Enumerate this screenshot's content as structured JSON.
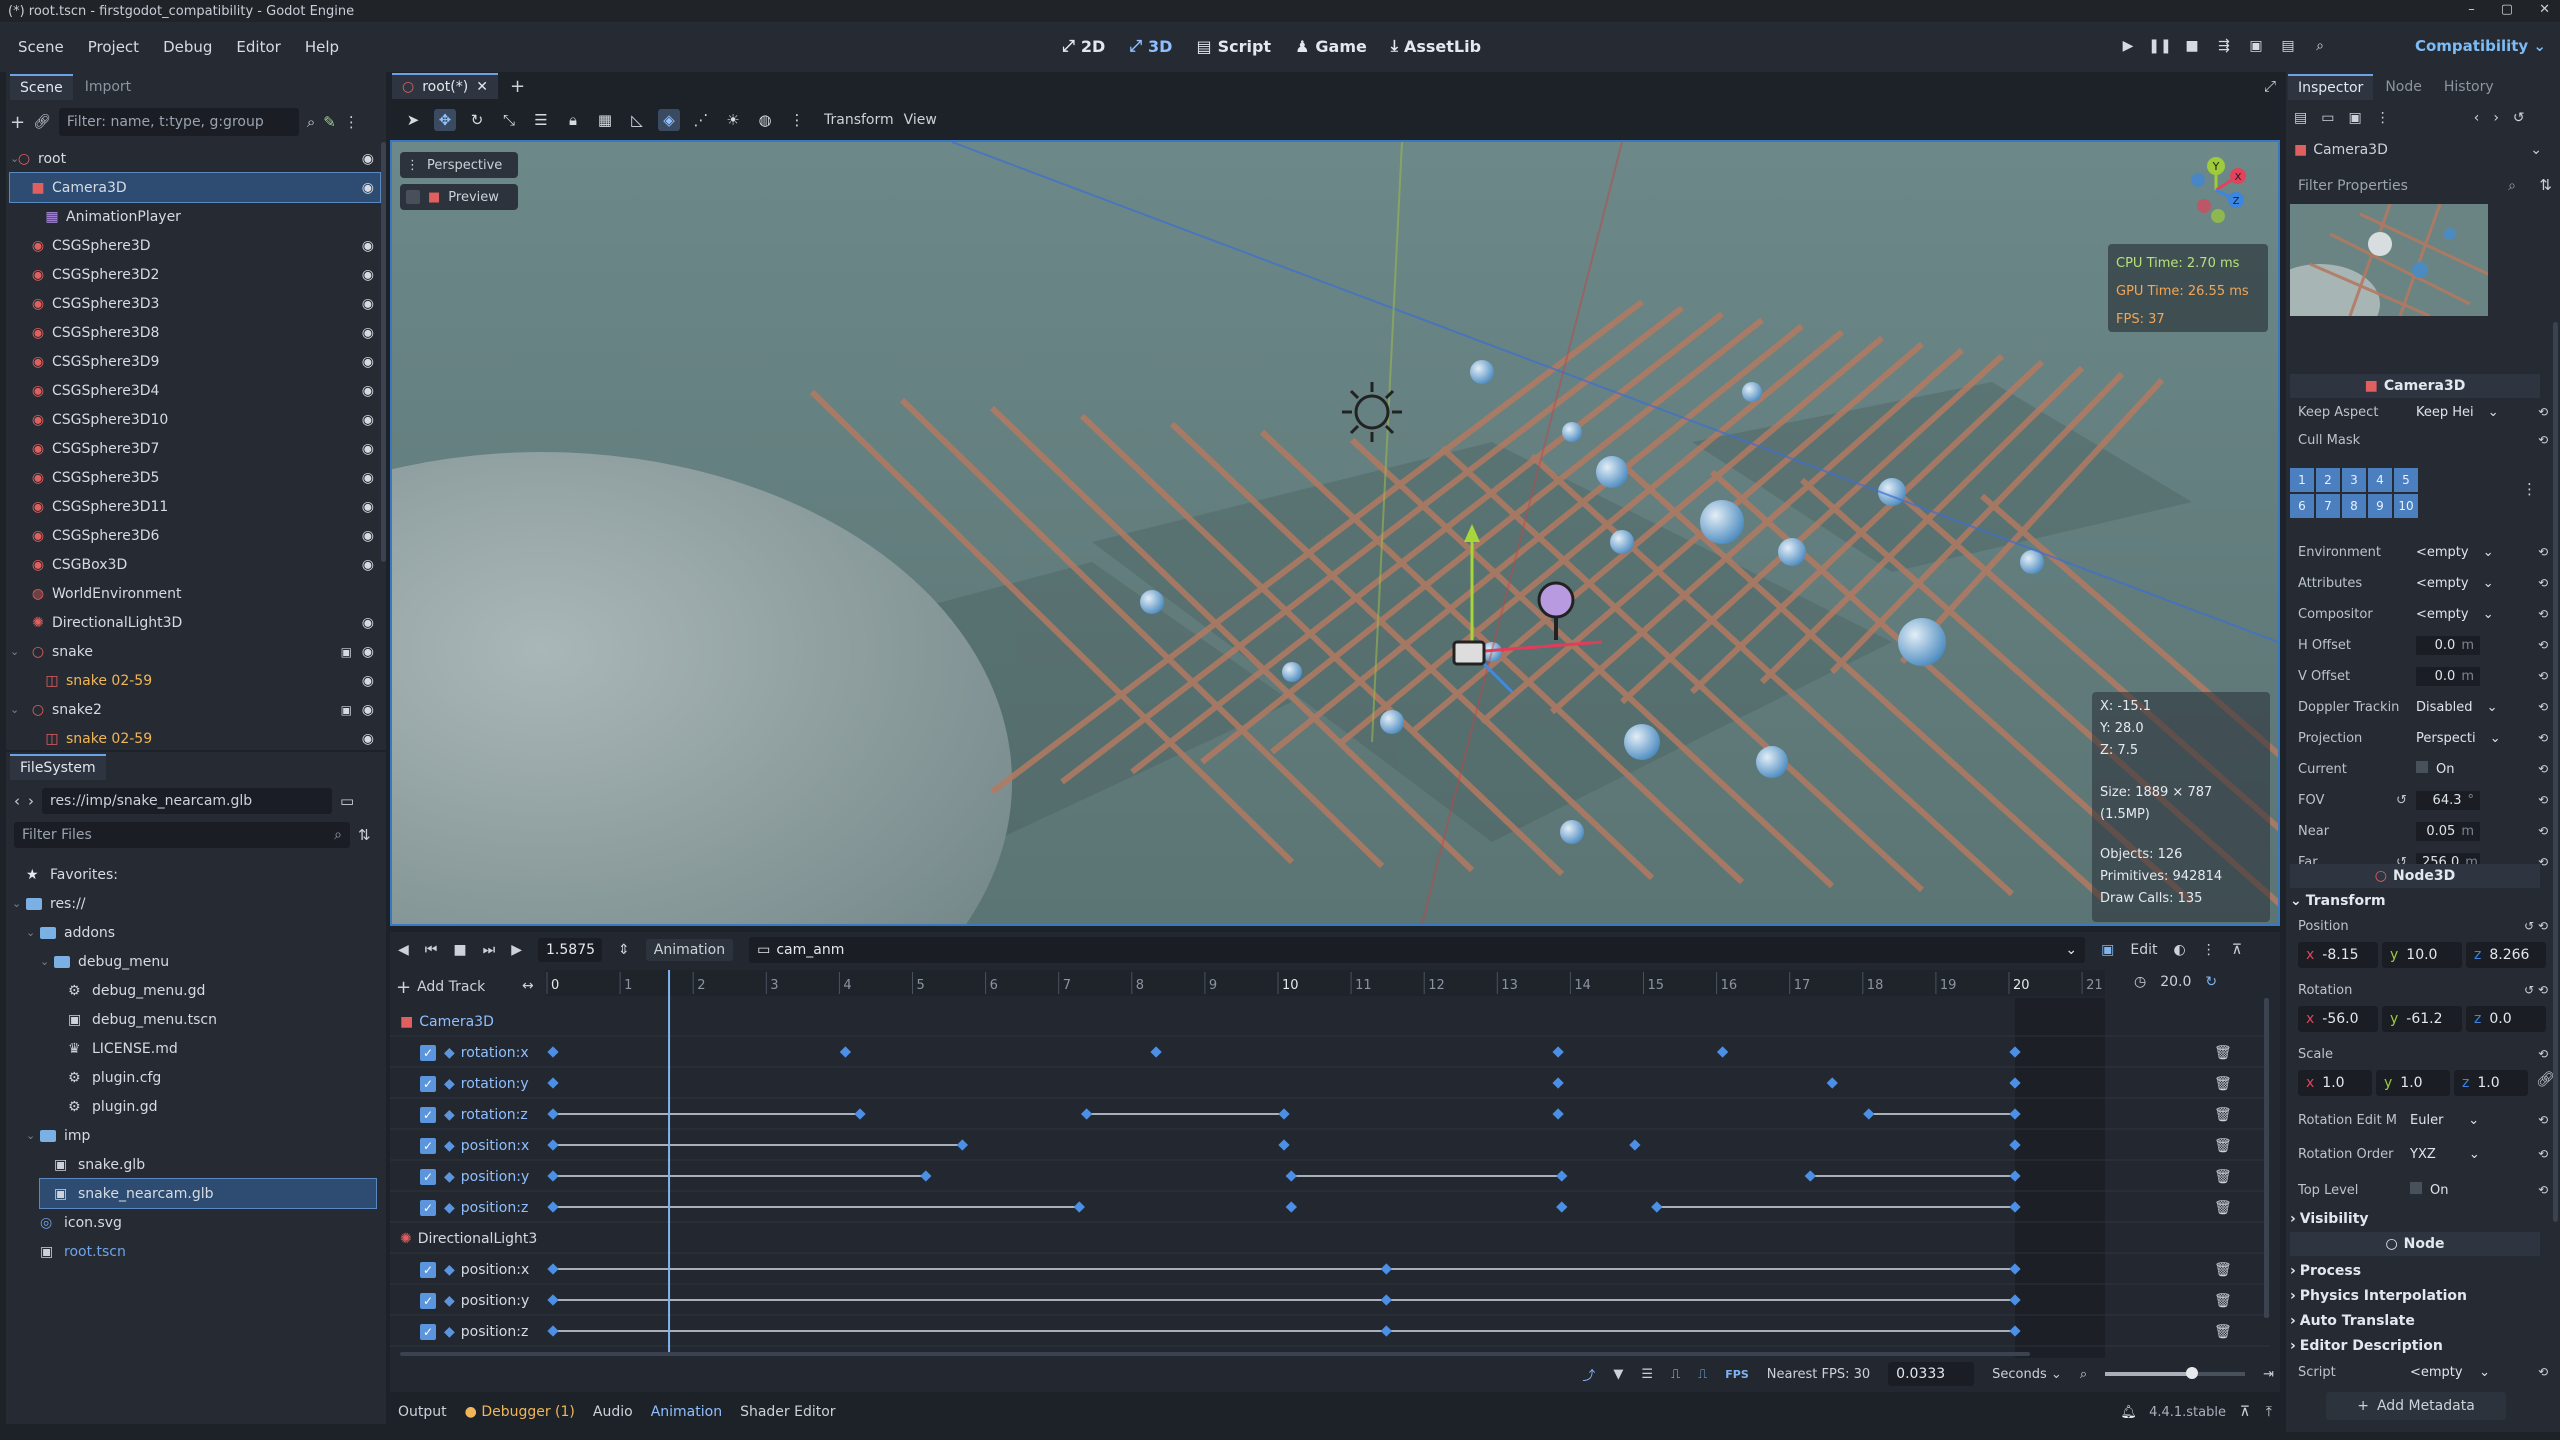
{
  "window": {
    "title": "(*) root.tscn - firstgodot_compatibility - Godot Engine",
    "controls": [
      "–",
      "▢",
      "✕"
    ]
  },
  "menu": [
    "Scene",
    "Project",
    "Debug",
    "Editor",
    "Help"
  ],
  "workspaces": [
    {
      "label": "2D",
      "icon": "2d-icon"
    },
    {
      "label": "3D",
      "icon": "3d-icon"
    },
    {
      "label": "Script",
      "icon": "script-icon"
    },
    {
      "label": "Game",
      "icon": "game-icon"
    },
    {
      "label": "AssetLib",
      "icon": "assetlib-icon"
    }
  ],
  "renderer": "Compatibility",
  "scene_panel": {
    "tabs": [
      "Scene",
      "Import"
    ],
    "filter_placeholder": "Filter: name, t:type, g:group",
    "nodes": [
      {
        "label": "root",
        "depth": 0,
        "icon": "node3d-icon",
        "color": "#e06060",
        "eye": true
      },
      {
        "label": "Camera3D",
        "depth": 1,
        "icon": "camera-icon",
        "color": "#e06060",
        "eye": true,
        "selected": true
      },
      {
        "label": "AnimationPlayer",
        "depth": 2,
        "icon": "animation-icon",
        "color": "#b08ee8",
        "eye": false
      },
      {
        "label": "CSGSphere3D",
        "depth": 1,
        "icon": "csg-icon",
        "color": "#e06060",
        "eye": true
      },
      {
        "label": "CSGSphere3D2",
        "depth": 1,
        "icon": "csg-icon",
        "color": "#e06060",
        "eye": true
      },
      {
        "label": "CSGSphere3D3",
        "depth": 1,
        "icon": "csg-icon",
        "color": "#e06060",
        "eye": true
      },
      {
        "label": "CSGSphere3D8",
        "depth": 1,
        "icon": "csg-icon",
        "color": "#e06060",
        "eye": true
      },
      {
        "label": "CSGSphere3D9",
        "depth": 1,
        "icon": "csg-icon",
        "color": "#e06060",
        "eye": true
      },
      {
        "label": "CSGSphere3D4",
        "depth": 1,
        "icon": "csg-icon",
        "color": "#e06060",
        "eye": true
      },
      {
        "label": "CSGSphere3D10",
        "depth": 1,
        "icon": "csg-icon",
        "color": "#e06060",
        "eye": true
      },
      {
        "label": "CSGSphere3D7",
        "depth": 1,
        "icon": "csg-icon",
        "color": "#e06060",
        "eye": true
      },
      {
        "label": "CSGSphere3D5",
        "depth": 1,
        "icon": "csg-icon",
        "color": "#e06060",
        "eye": true
      },
      {
        "label": "CSGSphere3D11",
        "depth": 1,
        "icon": "csg-icon",
        "color": "#e06060",
        "eye": true
      },
      {
        "label": "CSGSphere3D6",
        "depth": 1,
        "icon": "csg-icon",
        "color": "#e06060",
        "eye": true
      },
      {
        "label": "CSGBox3D",
        "depth": 1,
        "icon": "csg-icon",
        "color": "#e06060",
        "eye": true
      },
      {
        "label": "WorldEnvironment",
        "depth": 1,
        "icon": "world-icon",
        "color": "#e06060",
        "eye": false
      },
      {
        "label": "DirectionalLight3D",
        "depth": 1,
        "icon": "light-icon",
        "color": "#e06060",
        "eye": true
      },
      {
        "label": "snake",
        "depth": 1,
        "icon": "node3d-icon",
        "color": "#e06060",
        "eye": true,
        "expanded": true
      },
      {
        "label": "snake 02-59",
        "depth": 2,
        "icon": "mesh-icon",
        "color": "#e06060",
        "eye": true,
        "orange": true
      },
      {
        "label": "snake2",
        "depth": 1,
        "icon": "node3d-icon",
        "color": "#e06060",
        "eye": true,
        "expanded": true
      },
      {
        "label": "snake 02-59",
        "depth": 2,
        "icon": "mesh-icon",
        "color": "#e06060",
        "eye": true,
        "orange": true
      }
    ]
  },
  "filesystem": {
    "tab": "FileSystem",
    "path": "res://imp/snake_nearcam.glb",
    "filter_placeholder": "Filter Files",
    "items": [
      {
        "label": "Favorites:",
        "depth": 0,
        "kind": "star"
      },
      {
        "label": "res://",
        "depth": 0,
        "kind": "folder"
      },
      {
        "label": "addons",
        "depth": 1,
        "kind": "folder"
      },
      {
        "label": "debug_menu",
        "depth": 2,
        "kind": "folder"
      },
      {
        "label": "debug_menu.gd",
        "depth": 3,
        "kind": "gear"
      },
      {
        "label": "debug_menu.tscn",
        "depth": 3,
        "kind": "scene"
      },
      {
        "label": "LICENSE.md",
        "depth": 3,
        "kind": "doc"
      },
      {
        "label": "plugin.cfg",
        "depth": 3,
        "kind": "gear"
      },
      {
        "label": "plugin.gd",
        "depth": 3,
        "kind": "gear"
      },
      {
        "label": "imp",
        "depth": 1,
        "kind": "folder"
      },
      {
        "label": "snake.glb",
        "depth": 2,
        "kind": "scene"
      },
      {
        "label": "snake_nearcam.glb",
        "depth": 2,
        "kind": "scene",
        "selected": true
      },
      {
        "label": "icon.svg",
        "depth": 1,
        "kind": "svg"
      },
      {
        "label": "root.tscn",
        "depth": 1,
        "kind": "scene",
        "link": true
      }
    ]
  },
  "viewport": {
    "scene_tab": "root(*)",
    "toolbar_menus": [
      "Transform",
      "View"
    ],
    "perspective_label": "Perspective",
    "preview_label": "Preview",
    "perf": {
      "cpu": "CPU Time: 2.70 ms",
      "gpu": "GPU Time: 26.55 ms",
      "fps": "FPS: 37"
    },
    "coords": {
      "x": "X: -15.1",
      "y": "Y: 28.0",
      "z": "Z: 7.5"
    },
    "size": "Size: 1889 × 787 (1.5MP)",
    "stats": {
      "objects": "Objects: 126",
      "primitives": "Primitives: 942814",
      "drawcalls": "Draw Calls: 135"
    },
    "gizmo": {
      "y": "Y",
      "x": "X",
      "z": "Z"
    }
  },
  "animation": {
    "time": "1.5875",
    "menu_label": "Animation",
    "anim_name": "cam_anm",
    "edit_label": "Edit",
    "add_track": "Add Track",
    "length": "20.0",
    "ruler_labels": [
      "0",
      "1",
      "2",
      "3",
      "4",
      "5",
      "6",
      "7",
      "8",
      "9",
      "10",
      "11",
      "12",
      "13",
      "14",
      "15",
      "16",
      "17",
      "18",
      "19",
      "20",
      "21"
    ],
    "tracks": [
      {
        "group": "Camera3D",
        "icon": "camera-icon"
      },
      {
        "prop": "rotation:x",
        "keys": [
          0,
          4,
          8.25,
          13.75,
          16,
          20
        ],
        "lines": [],
        "active": true
      },
      {
        "prop": "rotation:y",
        "keys": [
          0,
          13.75,
          17.5,
          20
        ],
        "lines": [],
        "active": true
      },
      {
        "prop": "rotation:z",
        "keys": [
          0,
          4.2,
          7.3,
          10,
          13.75,
          18,
          20
        ],
        "lines": [
          [
            0,
            4.2
          ],
          [
            7.3,
            10
          ],
          [
            18,
            20
          ]
        ],
        "active": true
      },
      {
        "prop": "position:x",
        "keys": [
          0,
          5.6,
          10,
          14.8,
          20
        ],
        "lines": [
          [
            0,
            5.6
          ]
        ],
        "active": true
      },
      {
        "prop": "position:y",
        "keys": [
          0,
          5.1,
          10.1,
          13.8,
          17.2,
          20
        ],
        "lines": [
          [
            0,
            5.1
          ],
          [
            10.1,
            13.8
          ],
          [
            17.2,
            20
          ]
        ],
        "active": true
      },
      {
        "prop": "position:z",
        "keys": [
          0,
          7.2,
          10.1,
          13.8,
          15.1,
          20
        ],
        "lines": [
          [
            0,
            7.2
          ],
          [
            15.1,
            20
          ]
        ],
        "active": true
      },
      {
        "group": "DirectionalLight3",
        "icon": "light-icon"
      },
      {
        "prop": "position:x",
        "keys": [
          0,
          11.4,
          20
        ],
        "lines": [
          [
            0,
            20
          ]
        ],
        "active": true
      },
      {
        "prop": "position:y",
        "keys": [
          0,
          11.4,
          20
        ],
        "lines": [
          [
            0,
            20
          ]
        ],
        "active": true
      },
      {
        "prop": "position:z",
        "keys": [
          0,
          11.4,
          20
        ],
        "lines": [
          [
            0,
            20
          ]
        ],
        "active": true
      }
    ],
    "playhead": 1.5875,
    "snap_label": "Nearest FPS: 30",
    "step": "0.0333",
    "unit": "Seconds"
  },
  "bottom_tabs": [
    "Output",
    "Debugger (1)",
    "Audio",
    "Animation",
    "Shader Editor"
  ],
  "version": "4.4.1.stable",
  "inspector": {
    "tabs": [
      "Inspector",
      "Node",
      "History"
    ],
    "object": "Camera3D",
    "filter_placeholder": "Filter Properties",
    "class_header": "Camera3D",
    "props": [
      {
        "label": "Keep Aspect",
        "value": "Keep Hei",
        "dropdown": true
      },
      {
        "label": "Cull Mask",
        "value": ""
      },
      {
        "label": "Environment",
        "value": "<empty",
        "dropdown": true
      },
      {
        "label": "Attributes",
        "value": "<empty",
        "dropdown": true
      },
      {
        "label": "Compositor",
        "value": "<empty",
        "dropdown": true
      },
      {
        "label": "H Offset",
        "value": "0.0",
        "unit": "m"
      },
      {
        "label": "V Offset",
        "value": "0.0",
        "unit": "m"
      },
      {
        "label": "Doppler Trackin",
        "value": "Disabled",
        "dropdown": true
      },
      {
        "label": "Projection",
        "value": "Perspecti",
        "dropdown": true
      },
      {
        "label": "Current",
        "value": "On",
        "checkbox": true
      },
      {
        "label": "FOV",
        "value": "64.3",
        "unit": "°"
      },
      {
        "label": "Near",
        "value": "0.05",
        "unit": "m"
      },
      {
        "label": "Far",
        "value": "256.0",
        "unit": "m"
      }
    ],
    "layers": [
      "1",
      "2",
      "3",
      "4",
      "5",
      "6",
      "7",
      "8",
      "9",
      "10"
    ],
    "node3d_header": "Node3D",
    "transform": {
      "title": "Transform",
      "position_label": "Position",
      "position": {
        "x": "-8.15",
        "y": "10.0",
        "z": "8.266"
      },
      "rotation_label": "Rotation",
      "rotation": {
        "x": "-56.0",
        "y": "-61.2",
        "z": "0.0"
      },
      "scale_label": "Scale",
      "scale": {
        "x": "1.0",
        "y": "1.0",
        "z": "1.0"
      },
      "rot_edit_label": "Rotation Edit M",
      "rot_edit": "Euler",
      "rot_order_label": "Rotation Order",
      "rot_order": "YXZ",
      "top_level_label": "Top Level",
      "top_level": "On"
    },
    "visibility": "Visibility",
    "node_header": "Node",
    "sections": [
      "Process",
      "Physics Interpolation",
      "Auto Translate",
      "Editor Description"
    ],
    "script_label": "Script",
    "script_value": "<empty",
    "add_metadata": "Add Metadata"
  },
  "colors": {
    "accent": "#6ca3e8",
    "keyframe": "#4b8fe6",
    "orange": "#f0b657",
    "panel": "#262b33"
  }
}
